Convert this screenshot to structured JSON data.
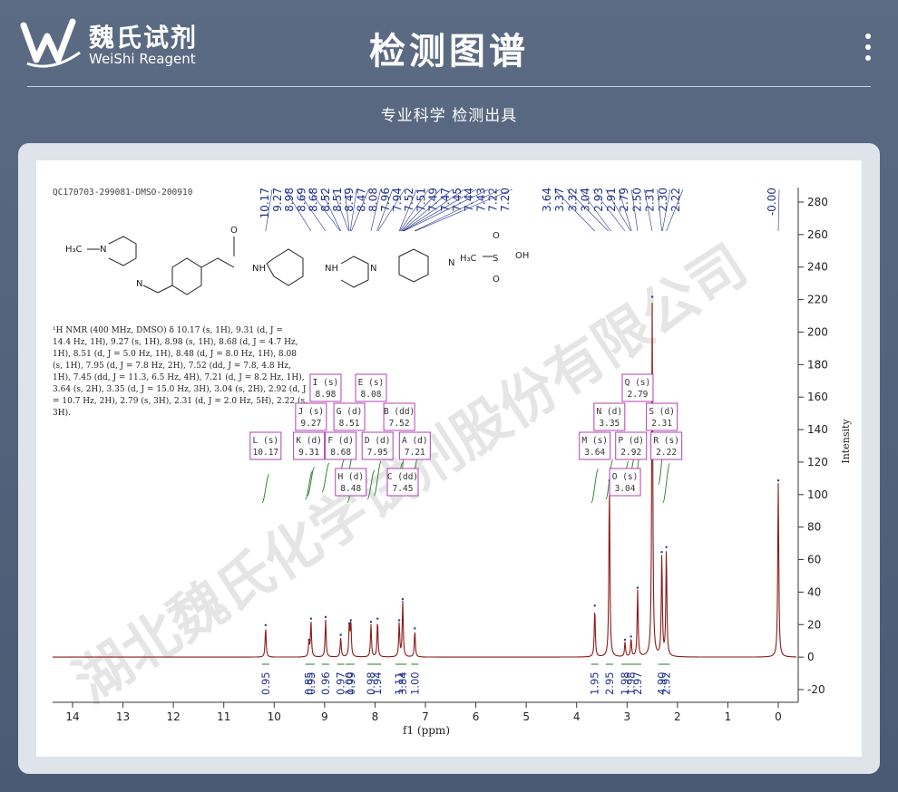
{
  "header": {
    "brand_cn": "魏氏试剂",
    "brand_en": "WeiShi Reagent",
    "title": "检测图谱",
    "subtitle": "专业科学  检测出具"
  },
  "watermark": "湖北魏氏化学试剂股份有限公司",
  "sample_id": "QC170703-299081-DMSO-200910",
  "nmr_text": [
    "¹H NMR (400 MHz, DMSO) δ 10.17 (s, 1H), 9.31 (d, J =",
    "14.4 Hz, 1H), 9.27 (s, 1H), 8.98 (s, 1H), 8.68 (d, J = 4.7 Hz,",
    "1H), 8.51 (d, J = 5.0 Hz, 1H), 8.48 (d, J = 8.0 Hz, 1H), 8.08",
    "(s, 1H), 7.95 (d, J = 7.8 Hz, 2H), 7.52 (dd, J = 7.8, 4.8 Hz,",
    "1H), 7.45 (dd, J = 11.3, 6.5 Hz, 4H), 7.21 (d, J = 8.2 Hz, 1H),",
    "3.64 (s, 2H), 3.35 (d, J = 15.0 Hz, 3H), 3.04 (s, 2H), 2.92 (d, J",
    "= 10.7 Hz, 2H), 2.79 (s, 3H), 2.31 (d, J = 2.0 Hz, 5H), 2.22 (s,",
    "3H)."
  ],
  "colors": {
    "spectrum": "#8b1a1a",
    "integral": "#2a7a2a",
    "peak_label": "#1f2f8c",
    "multiplet_box": "#b040b0"
  },
  "chart_data": {
    "type": "line",
    "xlabel": "f1 (ppm)",
    "ylabel": "Intensity",
    "xlim": [
      14.5,
      -0.4
    ],
    "ylim": [
      -28,
      288
    ],
    "x_ticks": [
      "14",
      "13",
      "12",
      "11",
      "10",
      "9",
      "8",
      "7",
      "6",
      "5",
      "4",
      "3",
      "2",
      "1",
      "0"
    ],
    "y_ticks": [
      "280",
      "260",
      "240",
      "220",
      "200",
      "180",
      "160",
      "140",
      "120",
      "100",
      "80",
      "60",
      "40",
      "20",
      "0",
      "-20"
    ],
    "peak_labels": [
      "10.17",
      "9.27",
      "8.98",
      "8.69",
      "8.68",
      "8.52",
      "8.51",
      "8.49",
      "8.47",
      "8.08",
      "7.96",
      "7.94",
      "7.52",
      "7.51",
      "7.49",
      "7.47",
      "7.45",
      "7.44",
      "7.43",
      "7.22",
      "7.20",
      "3.64",
      "3.37",
      "3.32",
      "3.04",
      "2.93",
      "2.91",
      "2.79",
      "2.50",
      "2.31",
      "2.30",
      "2.22",
      "-0.00"
    ],
    "peaks": [
      {
        "ppm": 10.17,
        "height": 18
      },
      {
        "ppm": 9.31,
        "height": 9
      },
      {
        "ppm": 9.27,
        "height": 22
      },
      {
        "ppm": 8.98,
        "height": 23
      },
      {
        "ppm": 8.68,
        "height": 12
      },
      {
        "ppm": 8.51,
        "height": 19
      },
      {
        "ppm": 8.48,
        "height": 21
      },
      {
        "ppm": 8.08,
        "height": 20
      },
      {
        "ppm": 7.95,
        "height": 22
      },
      {
        "ppm": 7.52,
        "height": 21
      },
      {
        "ppm": 7.45,
        "height": 34
      },
      {
        "ppm": 7.21,
        "height": 16
      },
      {
        "ppm": 3.64,
        "height": 30
      },
      {
        "ppm": 3.35,
        "height": 107
      },
      {
        "ppm": 3.04,
        "height": 9
      },
      {
        "ppm": 2.92,
        "height": 11
      },
      {
        "ppm": 2.79,
        "height": 41
      },
      {
        "ppm": 2.5,
        "height": 220
      },
      {
        "ppm": 2.31,
        "height": 63
      },
      {
        "ppm": 2.22,
        "height": 66
      },
      {
        "ppm": 0.0,
        "height": 107
      }
    ],
    "multiplets": [
      {
        "id": "L",
        "type": "s",
        "ppm": "10.17"
      },
      {
        "id": "K",
        "type": "d",
        "ppm": "9.31"
      },
      {
        "id": "J",
        "type": "s",
        "ppm": "9.27"
      },
      {
        "id": "I",
        "type": "s",
        "ppm": "8.98"
      },
      {
        "id": "F",
        "type": "d",
        "ppm": "8.68"
      },
      {
        "id": "G",
        "type": "d",
        "ppm": "8.51"
      },
      {
        "id": "H",
        "type": "d",
        "ppm": "8.48"
      },
      {
        "id": "E",
        "type": "s",
        "ppm": "8.08"
      },
      {
        "id": "D",
        "type": "d",
        "ppm": "7.95"
      },
      {
        "id": "B",
        "type": "dd",
        "ppm": "7.52"
      },
      {
        "id": "C",
        "type": "dd",
        "ppm": "7.45"
      },
      {
        "id": "A",
        "type": "d",
        "ppm": "7.21"
      },
      {
        "id": "M",
        "type": "s",
        "ppm": "3.64"
      },
      {
        "id": "N",
        "type": "d",
        "ppm": "3.35"
      },
      {
        "id": "O",
        "type": "s",
        "ppm": "3.04"
      },
      {
        "id": "P",
        "type": "d",
        "ppm": "2.92"
      },
      {
        "id": "Q",
        "type": "s",
        "ppm": "2.79"
      },
      {
        "id": "S",
        "type": "d",
        "ppm": "2.31"
      },
      {
        "id": "R",
        "type": "s",
        "ppm": "2.22"
      }
    ],
    "integrals": [
      {
        "ppm": 10.17,
        "value": "0.95"
      },
      {
        "ppm": 9.31,
        "value": "0.85"
      },
      {
        "ppm": 9.27,
        "value": "0.95"
      },
      {
        "ppm": 8.98,
        "value": "0.96"
      },
      {
        "ppm": 8.68,
        "value": "0.97"
      },
      {
        "ppm": 8.51,
        "value": "1.00"
      },
      {
        "ppm": 8.48,
        "value": "0.99"
      },
      {
        "ppm": 8.08,
        "value": "0.98"
      },
      {
        "ppm": 7.95,
        "value": "1.94"
      },
      {
        "ppm": 7.52,
        "value": "1.11"
      },
      {
        "ppm": 7.45,
        "value": "3.84"
      },
      {
        "ppm": 7.21,
        "value": "1.00"
      },
      {
        "ppm": 3.64,
        "value": "1.95"
      },
      {
        "ppm": 3.35,
        "value": "2.95"
      },
      {
        "ppm": 3.04,
        "value": "1.98"
      },
      {
        "ppm": 2.92,
        "value": "1.98"
      },
      {
        "ppm": 2.79,
        "value": "2.97"
      },
      {
        "ppm": 2.31,
        "value": "4.90"
      },
      {
        "ppm": 2.22,
        "value": "2.92"
      }
    ]
  }
}
